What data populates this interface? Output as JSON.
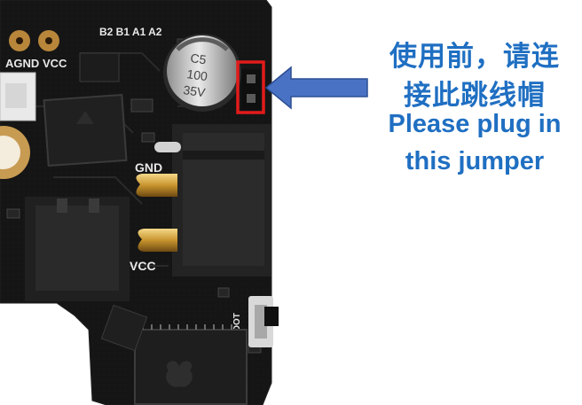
{
  "annotation": {
    "line1": "使用前，请连",
    "line2": "接此跳线帽",
    "line3": "Please plug in",
    "line4": "this jumper",
    "color": "#1f6fc2"
  },
  "board": {
    "silkscreen": {
      "top_pins": "B2 B1 A1 A2",
      "agnd": "AGND",
      "vcc_top": "VCC",
      "gnd": "GND",
      "vcc_lower": "VCC",
      "boot": "BOOT",
      "capacitor_l1": "C5",
      "capacitor_l2": "100",
      "capacitor_l3": "35V"
    },
    "pcb_color": "#141414",
    "highlight_color": "#e21b1b",
    "arrow_color": "#4a72c4"
  }
}
